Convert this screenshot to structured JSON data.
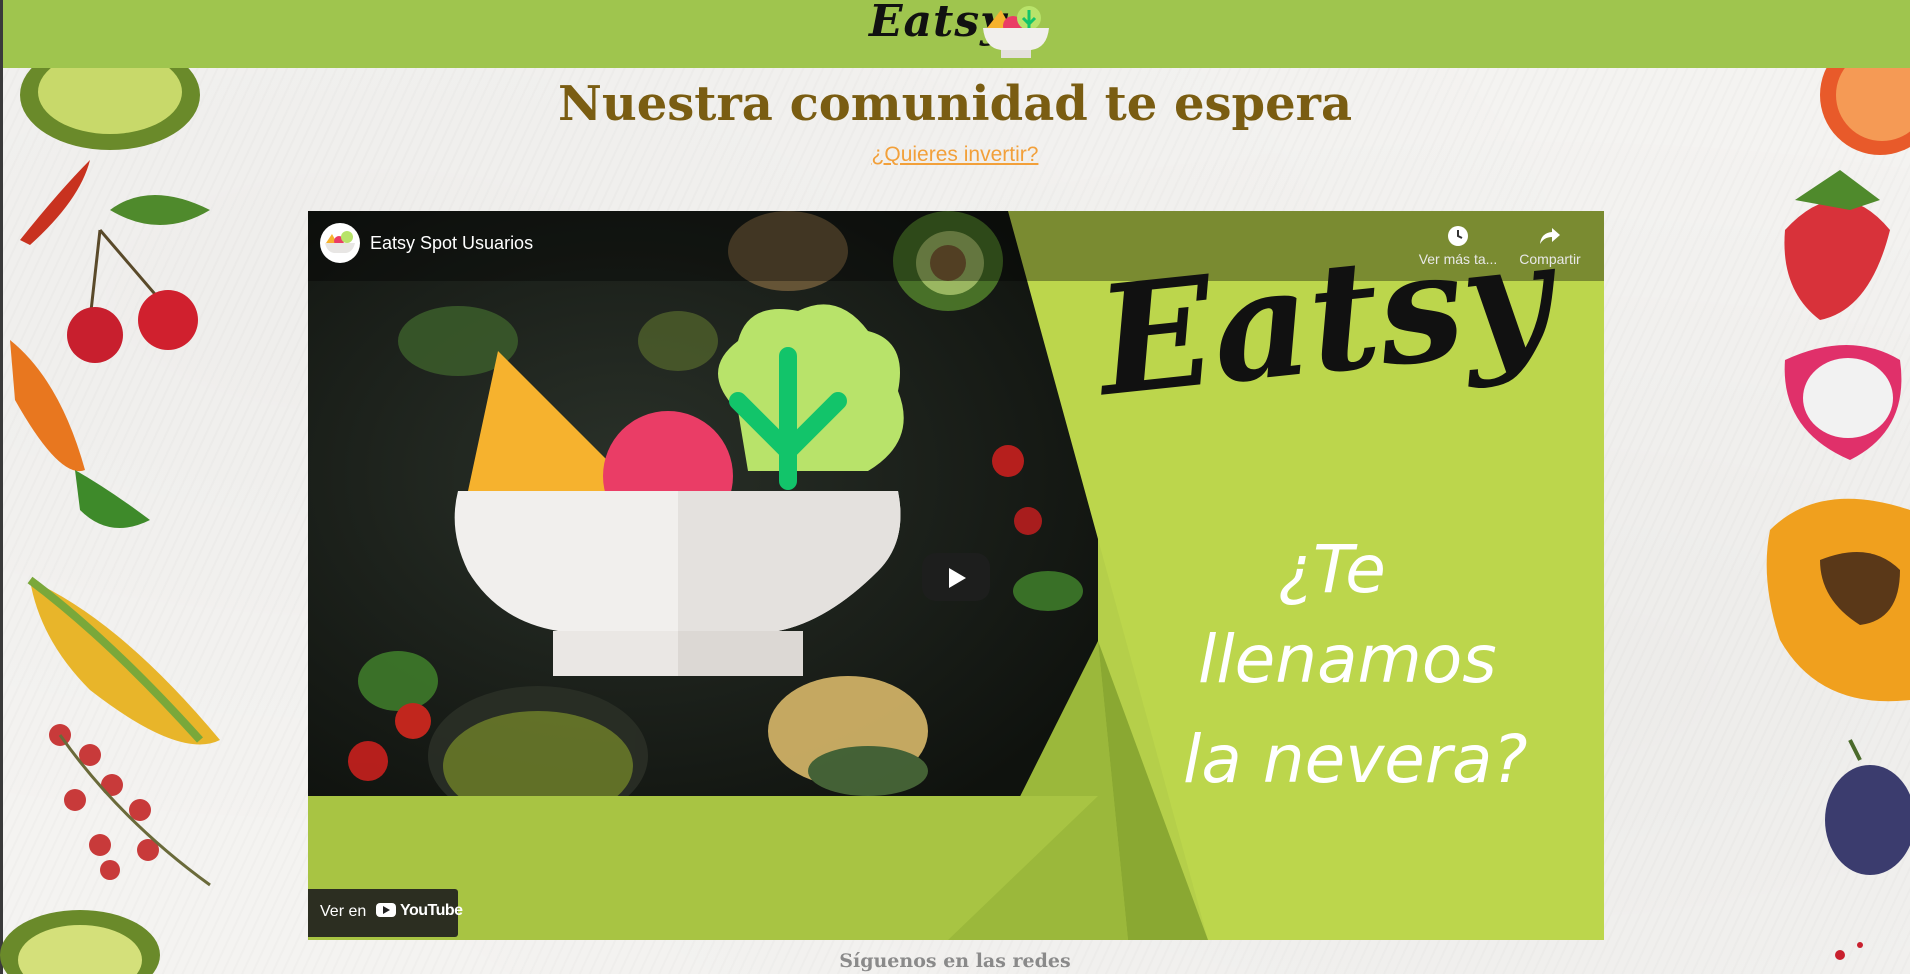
{
  "header": {
    "brand": "Eatsy",
    "bg_color": "#9fc54e"
  },
  "main": {
    "title": "Nuestra comunidad te espera",
    "invest_link": "¿Quieres invertir?",
    "title_color": "#7a5d12",
    "link_color": "#f2a03a"
  },
  "video": {
    "channel_title": "Eatsy Spot Usuarios",
    "watch_later": "Ver más ta...",
    "share": "Compartir",
    "watch_on": "Ver en",
    "youtube": "YouTube",
    "thumb_brand": "Eatsy",
    "thumb_line1": "¿Te",
    "thumb_line2": "llenamos",
    "thumb_line3": "la nevera?",
    "icons": [
      "clock-icon",
      "share-icon",
      "play-icon",
      "youtube-icon"
    ]
  },
  "footer": {
    "social_heading": "Síguenos en las redes"
  }
}
